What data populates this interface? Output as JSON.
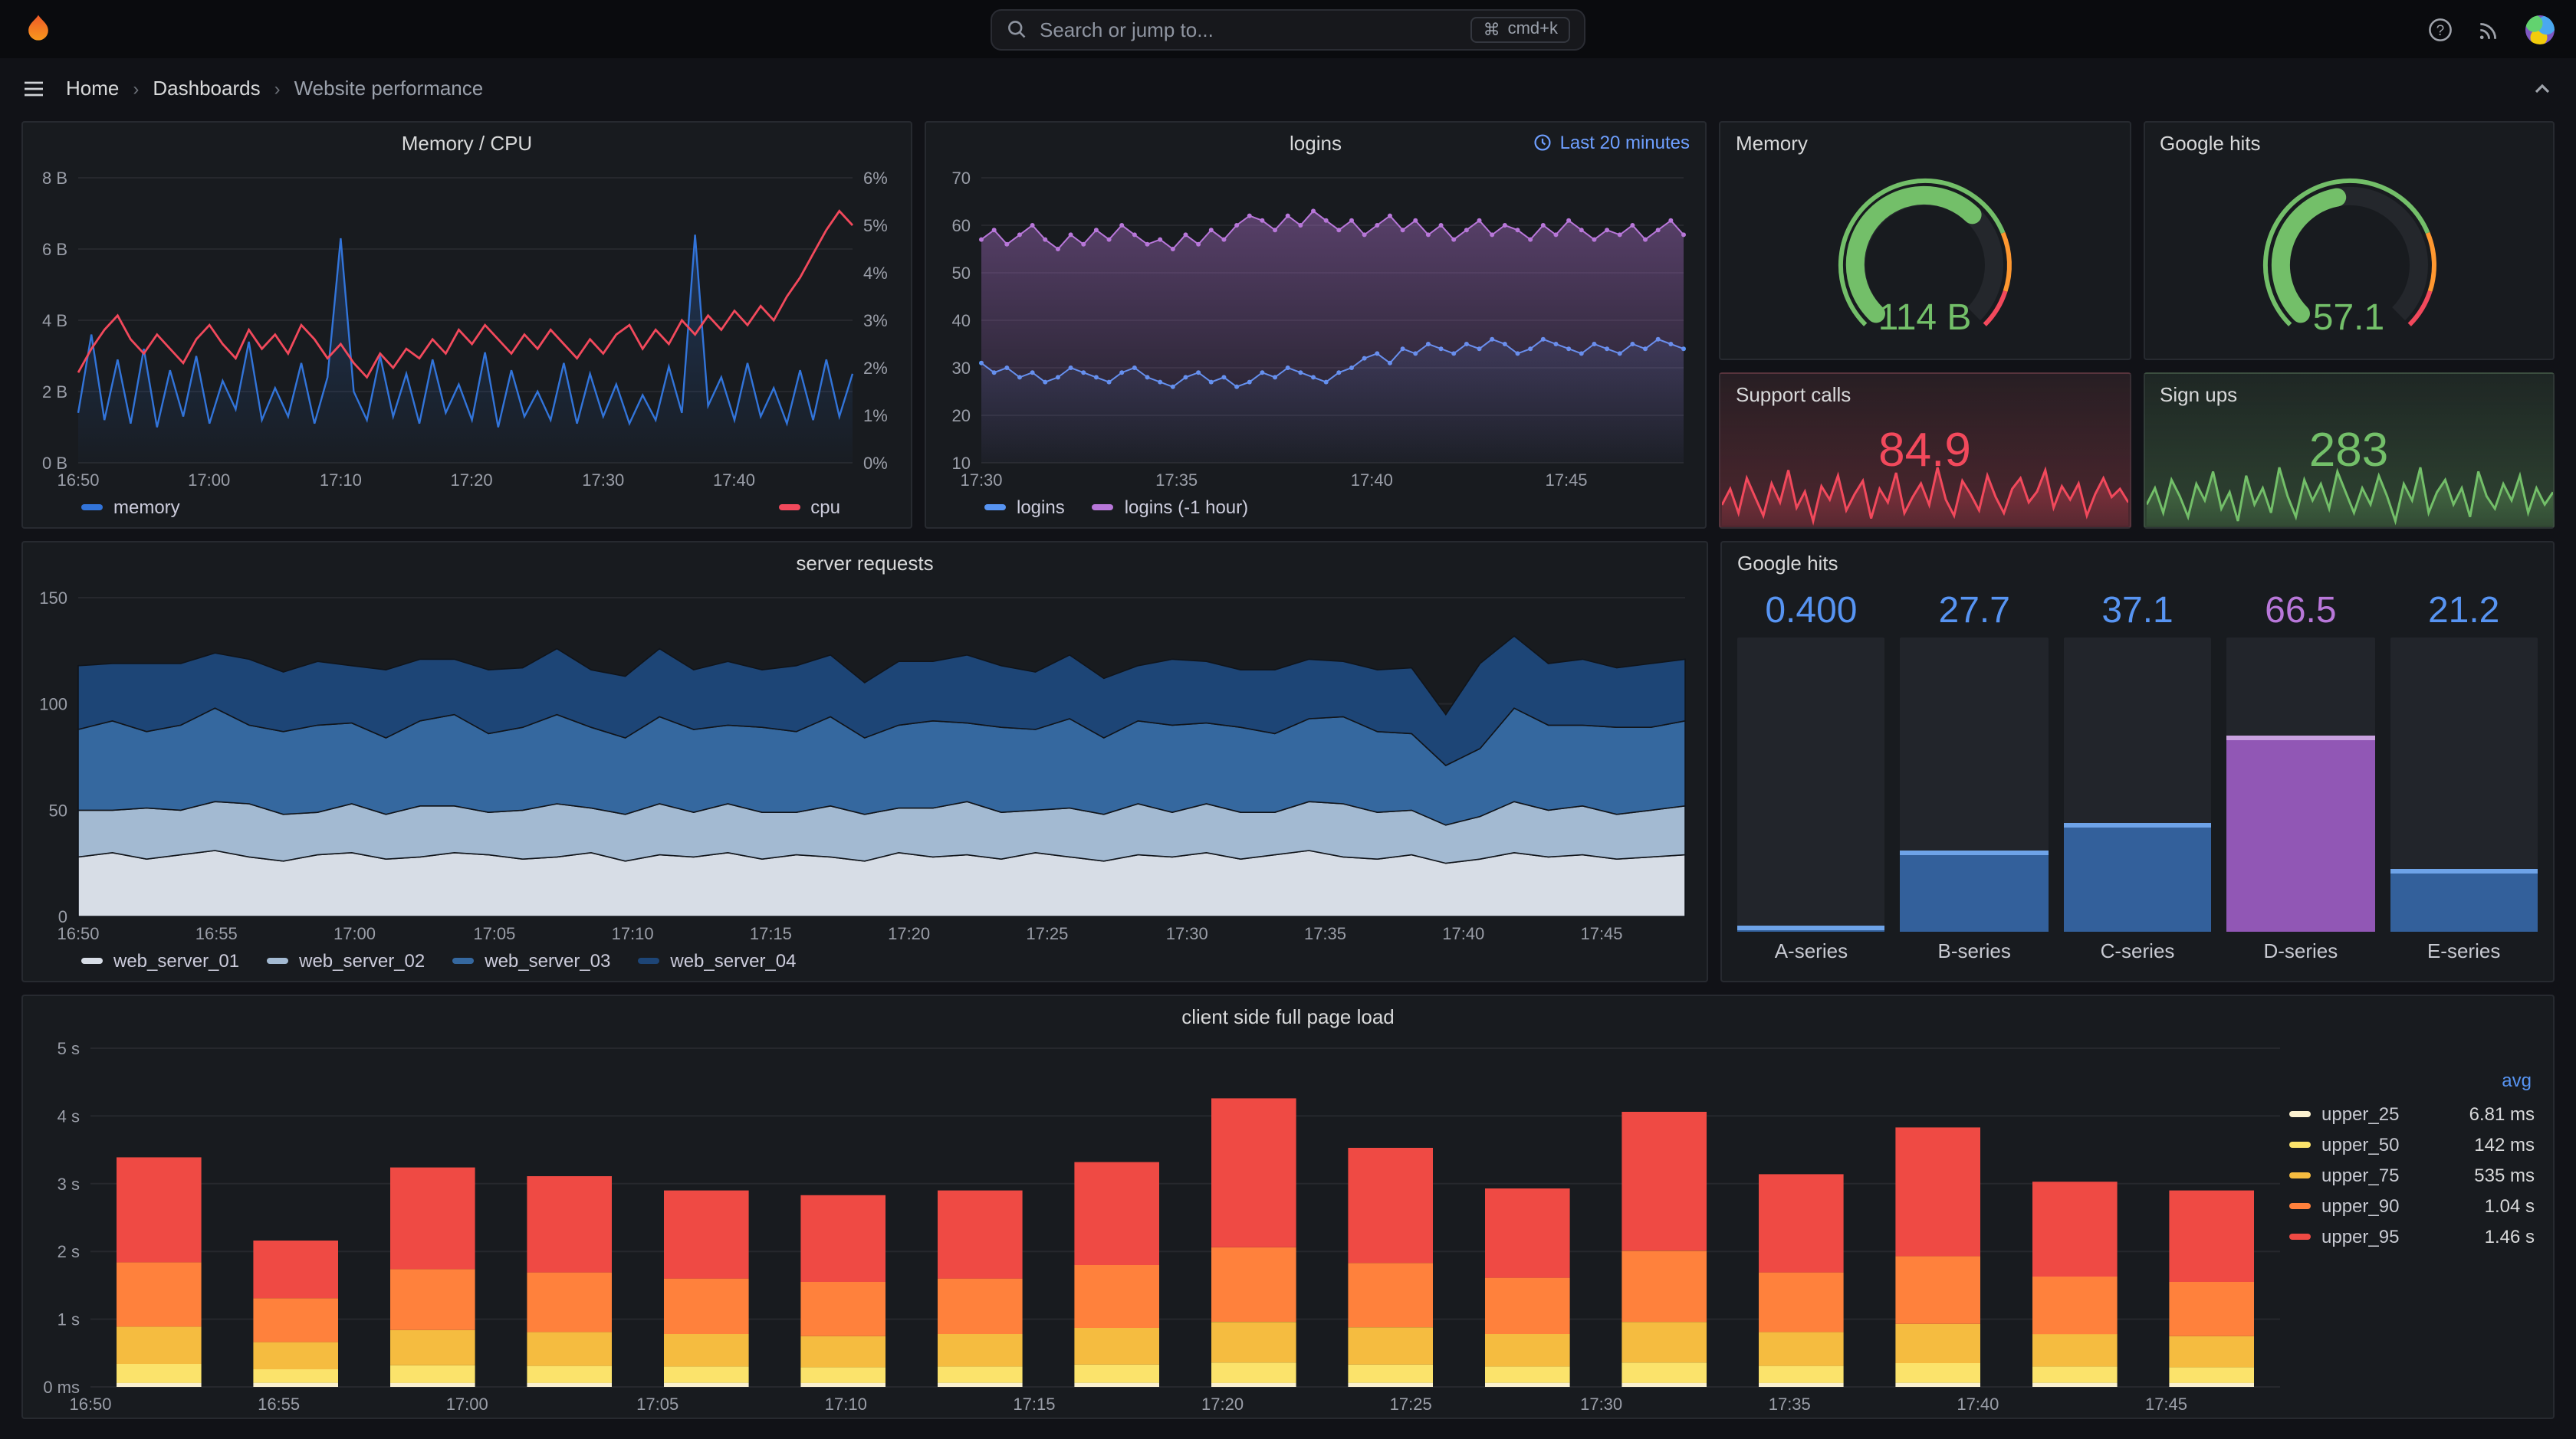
{
  "topbar": {
    "search_placeholder": "Search or jump to...",
    "shortcut": "cmd+k"
  },
  "icons": {
    "help": "?",
    "cmd": "⌘"
  },
  "nav": {
    "breadcrumb": [
      "Home",
      "Dashboards",
      "Website performance"
    ],
    "separator": "›"
  },
  "chart_data": [
    {
      "id": "memory_cpu",
      "type": "line",
      "title": "Memory / CPU",
      "x_ticks": [
        "16:50",
        "17:00",
        "17:10",
        "17:20",
        "17:30",
        "17:40"
      ],
      "x_tick_pos": [
        0,
        0.169,
        0.339,
        0.508,
        0.678,
        0.847
      ],
      "y_left": {
        "min": 0,
        "max": 8,
        "ticks": [
          "0 B",
          "2 B",
          "4 B",
          "6 B",
          "8 B"
        ]
      },
      "y_right": {
        "min": 0,
        "max": 6,
        "ticks": [
          "0%",
          "1%",
          "2%",
          "3%",
          "4%",
          "5%",
          "6%"
        ]
      },
      "series": [
        {
          "name": "memory",
          "color": "#3274d9",
          "axis": "left",
          "fill": 0.3,
          "width": 1.2,
          "values": [
            1.4,
            3.6,
            1.2,
            2.9,
            1.1,
            3.2,
            1.0,
            2.6,
            1.3,
            3.0,
            1.1,
            2.3,
            1.5,
            3.4,
            1.2,
            2.1,
            1.3,
            2.8,
            1.1,
            2.4,
            6.3,
            2.0,
            1.2,
            3.0,
            1.3,
            2.5,
            1.1,
            2.9,
            1.4,
            2.2,
            1.2,
            3.1,
            1.0,
            2.6,
            1.3,
            2.0,
            1.2,
            2.8,
            1.1,
            2.5,
            1.3,
            2.2,
            1.1,
            1.9,
            1.2,
            2.7,
            1.4,
            6.4,
            1.6,
            2.4,
            1.2,
            2.8,
            1.3,
            2.1,
            1.1,
            2.6,
            1.2,
            2.9,
            1.3,
            2.5
          ]
        },
        {
          "name": "cpu",
          "color": "#f2495c",
          "axis": "right",
          "width": 1.4,
          "values": [
            1.9,
            2.4,
            2.8,
            3.1,
            2.6,
            2.3,
            2.7,
            2.4,
            2.1,
            2.6,
            2.9,
            2.5,
            2.2,
            2.8,
            2.4,
            2.7,
            2.3,
            2.9,
            2.6,
            2.2,
            2.5,
            2.1,
            1.8,
            2.3,
            2.0,
            2.4,
            2.2,
            2.6,
            2.3,
            2.8,
            2.5,
            2.9,
            2.6,
            2.3,
            2.7,
            2.4,
            2.8,
            2.5,
            2.2,
            2.6,
            2.3,
            2.7,
            2.9,
            2.4,
            2.8,
            2.5,
            3.0,
            2.7,
            3.1,
            2.8,
            3.2,
            2.9,
            3.3,
            3.0,
            3.5,
            3.9,
            4.4,
            4.9,
            5.3,
            5.0
          ]
        }
      ]
    },
    {
      "id": "logins",
      "type": "line",
      "title": "logins",
      "timerange": "Last 20 minutes",
      "x_ticks": [
        "17:30",
        "17:35",
        "17:40",
        "17:45"
      ],
      "x_tick_pos": [
        0,
        0.278,
        0.556,
        0.833
      ],
      "y_left": {
        "min": 10,
        "max": 70,
        "ticks": [
          "10",
          "20",
          "30",
          "40",
          "50",
          "60",
          "70"
        ]
      },
      "series": [
        {
          "name": "logins",
          "color": "#5794f2",
          "axis": "left",
          "fill": 0.12,
          "width": 1,
          "points": true,
          "values": [
            31,
            29,
            30,
            28,
            29,
            27,
            28,
            30,
            29,
            28,
            27,
            29,
            30,
            28,
            27,
            26,
            28,
            29,
            27,
            28,
            26,
            27,
            29,
            28,
            30,
            29,
            28,
            27,
            29,
            30,
            32,
            33,
            31,
            34,
            33,
            35,
            34,
            33,
            35,
            34,
            36,
            35,
            33,
            34,
            36,
            35,
            34,
            33,
            35,
            34,
            33,
            35,
            34,
            36,
            35,
            34
          ]
        },
        {
          "name": "logins (-1 hour)",
          "color": "#b877d9",
          "axis": "left",
          "fill": 0.4,
          "width": 1,
          "points": true,
          "values": [
            57,
            59,
            56,
            58,
            60,
            57,
            55,
            58,
            56,
            59,
            57,
            60,
            58,
            56,
            57,
            55,
            58,
            56,
            59,
            57,
            60,
            62,
            61,
            59,
            62,
            60,
            63,
            61,
            59,
            61,
            58,
            60,
            62,
            59,
            61,
            58,
            60,
            57,
            59,
            61,
            58,
            60,
            59,
            57,
            60,
            58,
            61,
            59,
            57,
            59,
            58,
            60,
            57,
            59,
            61,
            58
          ]
        }
      ]
    },
    {
      "id": "memory_gauge",
      "type": "gauge",
      "title": "Memory",
      "value": "114 B",
      "percent": 0.66,
      "color": "#73bf69",
      "thresholds": [
        {
          "to": 0.75,
          "color": "#73bf69"
        },
        {
          "to": 0.9,
          "color": "#ff9830"
        },
        {
          "to": 1,
          "color": "#f2495c"
        }
      ]
    },
    {
      "id": "google_gauge",
      "type": "gauge",
      "title": "Google hits",
      "value": "57.1",
      "percent": 0.46,
      "color": "#73bf69",
      "thresholds": [
        {
          "to": 0.75,
          "color": "#73bf69"
        },
        {
          "to": 0.9,
          "color": "#ff9830"
        },
        {
          "to": 1,
          "color": "#f2495c"
        }
      ]
    },
    {
      "id": "support_calls",
      "type": "stat",
      "title": "Support calls",
      "value": "84.9",
      "color": "#f2495c",
      "spark": [
        82,
        88,
        79,
        92,
        85,
        78,
        90,
        83,
        95,
        81,
        87,
        76,
        89,
        84,
        93,
        80,
        86,
        91,
        77,
        88,
        83,
        94,
        79,
        85,
        90,
        82,
        96,
        84,
        78,
        91,
        86,
        80,
        93,
        85,
        79,
        88,
        92,
        83,
        87,
        95,
        81,
        89,
        84,
        90,
        78,
        86,
        92,
        85,
        88,
        83
      ]
    },
    {
      "id": "sign_ups",
      "type": "stat",
      "title": "Sign ups",
      "value": "283",
      "color": "#73bf69",
      "spark": [
        260,
        300,
        240,
        320,
        280,
        230,
        310,
        270,
        340,
        250,
        290,
        220,
        330,
        260,
        300,
        240,
        350,
        280,
        230,
        320,
        270,
        310,
        250,
        340,
        290,
        240,
        300,
        260,
        330,
        280,
        220,
        310,
        270,
        350,
        240,
        290,
        320,
        260,
        300,
        230,
        340,
        280,
        250,
        310,
        270,
        330,
        240,
        300,
        260,
        290
      ]
    },
    {
      "id": "server_requests",
      "type": "stacked_area",
      "title": "server requests",
      "max": 150,
      "y_ticks": [
        "0",
        "50",
        "100",
        "150"
      ],
      "x_ticks": [
        "16:50",
        "16:55",
        "17:00",
        "17:05",
        "17:10",
        "17:15",
        "17:20",
        "17:25",
        "17:30",
        "17:35",
        "17:40",
        "17:45"
      ],
      "x_tick_pos": [
        0,
        0.086,
        0.172,
        0.259,
        0.345,
        0.431,
        0.517,
        0.603,
        0.69,
        0.776,
        0.862,
        0.948
      ],
      "series": [
        {
          "name": "web_server_01",
          "color": "#d7dde6",
          "values": [
            28,
            30,
            27,
            29,
            31,
            28,
            26,
            29,
            30,
            27,
            28,
            30,
            29,
            27,
            28,
            30,
            26,
            29,
            28,
            30,
            27,
            29,
            28,
            26,
            30,
            28,
            29,
            27,
            30,
            28,
            26,
            29,
            28,
            30,
            27,
            29,
            31,
            28,
            27,
            29,
            25,
            27,
            30,
            28,
            29,
            27,
            28,
            29
          ]
        },
        {
          "name": "web_server_02",
          "color": "#a3bad2",
          "values": [
            22,
            20,
            24,
            21,
            23,
            25,
            22,
            20,
            23,
            21,
            24,
            22,
            20,
            23,
            25,
            21,
            22,
            24,
            21,
            23,
            22,
            20,
            24,
            22,
            21,
            23,
            25,
            22,
            20,
            23,
            22,
            24,
            21,
            23,
            22,
            20,
            23,
            25,
            22,
            21,
            18,
            20,
            24,
            22,
            23,
            21,
            22,
            23
          ]
        },
        {
          "name": "web_server_03",
          "color": "#35689f",
          "values": [
            38,
            42,
            36,
            40,
            44,
            37,
            39,
            41,
            38,
            36,
            40,
            43,
            37,
            39,
            42,
            38,
            36,
            41,
            39,
            37,
            40,
            38,
            42,
            36,
            39,
            41,
            37,
            40,
            38,
            42,
            36,
            39,
            41,
            38,
            40,
            37,
            39,
            41,
            38,
            36,
            28,
            32,
            44,
            40,
            38,
            41,
            39,
            40
          ]
        },
        {
          "name": "web_server_04",
          "color": "#1d4576",
          "values": [
            30,
            27,
            32,
            29,
            26,
            31,
            28,
            30,
            27,
            32,
            29,
            26,
            30,
            28,
            31,
            27,
            29,
            32,
            28,
            30,
            27,
            31,
            29,
            26,
            30,
            28,
            32,
            29,
            27,
            30,
            28,
            26,
            31,
            29,
            27,
            30,
            28,
            26,
            29,
            31,
            24,
            40,
            34,
            29,
            31,
            28,
            30,
            29
          ]
        }
      ]
    },
    {
      "id": "google_hits_bars",
      "type": "bargauge",
      "title": "Google hits",
      "max": 100,
      "bars": [
        {
          "label": "A-series",
          "display": "0.400",
          "value": 0.4,
          "text_color": "#5794f2",
          "fill": "#33609b",
          "edge": "#6ea3e8"
        },
        {
          "label": "B-series",
          "display": "27.7",
          "value": 27.7,
          "text_color": "#5794f2",
          "fill": "#33609b",
          "edge": "#6ea3e8"
        },
        {
          "label": "C-series",
          "display": "37.1",
          "value": 37.1,
          "text_color": "#5794f2",
          "fill": "#33609b",
          "edge": "#6ea3e8"
        },
        {
          "label": "D-series",
          "display": "66.5",
          "value": 66.5,
          "text_color": "#b877d9",
          "fill": "#9157b5",
          "edge": "#c9a1e0"
        },
        {
          "label": "E-series",
          "display": "21.2",
          "value": 21.2,
          "text_color": "#5794f2",
          "fill": "#33609b",
          "edge": "#6ea3e8"
        }
      ]
    },
    {
      "id": "page_load",
      "type": "stacked_bars",
      "title": "client side full page load",
      "max": 5,
      "legend_header": "avg",
      "y_ticks": [
        "0 ms",
        "1 s",
        "2 s",
        "3 s",
        "4 s",
        "5 s"
      ],
      "x_ticks": [
        "16:50",
        "16:55",
        "17:00",
        "17:05",
        "17:10",
        "17:15",
        "17:20",
        "17:25",
        "17:30",
        "17:35",
        "17:40",
        "17:45"
      ],
      "x_tick_pos": [
        0,
        0.086,
        0.172,
        0.259,
        0.345,
        0.431,
        0.517,
        0.603,
        0.69,
        0.776,
        0.862,
        0.948
      ],
      "series": [
        {
          "name": "upper_25",
          "color": "#fbf1cf",
          "avg": "6.81 ms",
          "values": [
            0.06,
            0.06,
            0.06,
            0.06,
            0.06,
            0.06,
            0.06,
            0.06,
            0.06,
            0.06,
            0.06,
            0.06,
            0.06,
            0.06,
            0.06,
            0.06
          ]
        },
        {
          "name": "upper_50",
          "color": "#fbe36b",
          "avg": "142 ms",
          "values": [
            0.28,
            0.2,
            0.26,
            0.25,
            0.24,
            0.23,
            0.24,
            0.27,
            0.3,
            0.27,
            0.24,
            0.3,
            0.25,
            0.29,
            0.24,
            0.23
          ]
        },
        {
          "name": "upper_75",
          "color": "#f5bc40",
          "avg": "535 ms",
          "values": [
            0.55,
            0.4,
            0.52,
            0.5,
            0.48,
            0.46,
            0.48,
            0.54,
            0.6,
            0.55,
            0.48,
            0.6,
            0.5,
            0.58,
            0.48,
            0.46
          ]
        },
        {
          "name": "upper_90",
          "color": "#ff813c",
          "avg": "1.04 s",
          "values": [
            0.95,
            0.65,
            0.9,
            0.88,
            0.82,
            0.8,
            0.82,
            0.93,
            1.1,
            0.95,
            0.83,
            1.05,
            0.88,
            1.0,
            0.85,
            0.8
          ]
        },
        {
          "name": "upper_95",
          "color": "#ef4a44",
          "avg": "1.46 s",
          "values": [
            1.55,
            0.85,
            1.5,
            1.42,
            1.3,
            1.28,
            1.3,
            1.52,
            2.2,
            1.7,
            1.32,
            2.05,
            1.45,
            1.9,
            1.4,
            1.35
          ]
        }
      ]
    }
  ]
}
